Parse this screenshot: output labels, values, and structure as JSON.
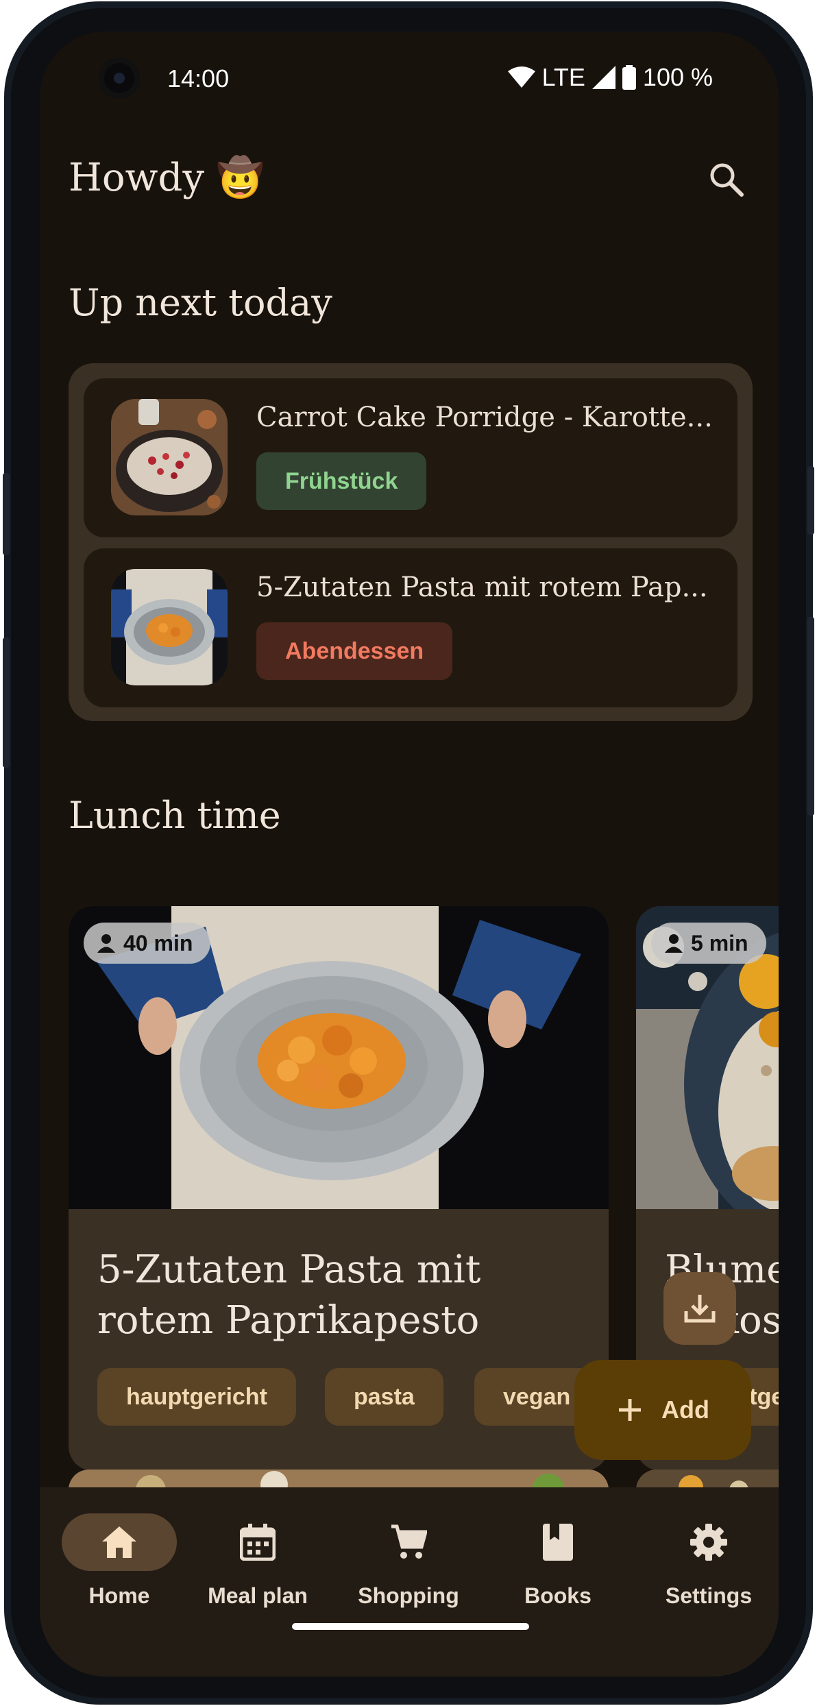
{
  "status_bar": {
    "time": "14:00",
    "network": "LTE",
    "battery": "100 %"
  },
  "header": {
    "greeting": "Howdy 🤠"
  },
  "up_next": {
    "title": "Up next today",
    "items": [
      {
        "title": "Carrot Cake Porridge - Karotte...",
        "badge": "Frühstück",
        "badge_bg": "#334332",
        "badge_color": "#8fd48f"
      },
      {
        "title": "5-Zutaten Pasta mit rotem Pap...",
        "badge": "Abendessen",
        "badge_bg": "#4b261c",
        "badge_color": "#f27a60"
      }
    ]
  },
  "lunch": {
    "title": "Lunch time",
    "cards": [
      {
        "time": "40 min",
        "title": "5-Zutaten Pasta mit rotem Paprikapesto",
        "tags": [
          "hauptgericht",
          "pasta",
          "vegan"
        ]
      },
      {
        "time": "5 min",
        "title": "Blume Kokos-",
        "tags": [
          "hauptge"
        ]
      }
    ]
  },
  "fab": {
    "add_label": "Add"
  },
  "nav": {
    "items": [
      {
        "label": "Home",
        "icon": "home-icon",
        "active": true
      },
      {
        "label": "Meal plan",
        "icon": "calendar-icon"
      },
      {
        "label": "Shopping",
        "icon": "cart-icon"
      },
      {
        "label": "Books",
        "icon": "book-icon"
      },
      {
        "label": "Settings",
        "icon": "gear-icon"
      }
    ]
  },
  "colors": {
    "background": "#18120d",
    "surface": "#3b3024",
    "accent": "#5b3d06",
    "text": "#f1e6db"
  }
}
